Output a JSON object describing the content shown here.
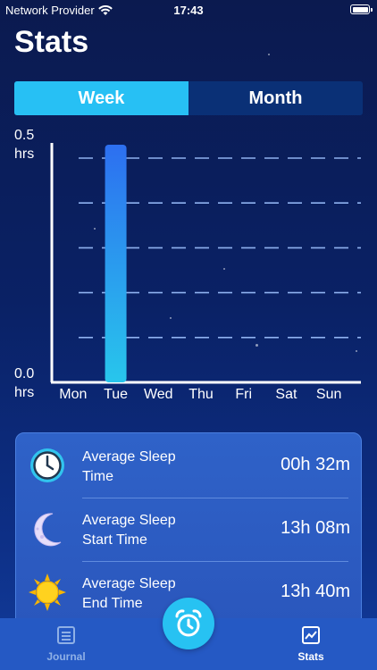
{
  "status_bar": {
    "carrier": "Network Provider",
    "time": "17:43"
  },
  "title": "Stats",
  "segmented": {
    "week": "Week",
    "month": "Month",
    "selected": "Week"
  },
  "chart_data": {
    "type": "bar",
    "categories": [
      "Mon",
      "Tue",
      "Wed",
      "Thu",
      "Fri",
      "Sat",
      "Sun"
    ],
    "values": [
      0,
      0.53,
      0,
      0,
      0,
      0,
      0
    ],
    "ylim": [
      0,
      0.5
    ],
    "y_top_label": {
      "value": "0.5",
      "unit": "hrs"
    },
    "y_bottom_label": {
      "value": "0.0",
      "unit": "hrs"
    },
    "grid": true
  },
  "stats": [
    {
      "label_line1": "Average Sleep",
      "label_line2": "Time",
      "value": "00h 32m",
      "icon": "clock-icon"
    },
    {
      "label_line1": "Average Sleep",
      "label_line2": "Start Time",
      "value": "13h 08m",
      "icon": "moon-icon"
    },
    {
      "label_line1": "Average Sleep",
      "label_line2": "End Time",
      "value": "13h 40m",
      "icon": "sun-icon"
    }
  ],
  "tabbar": {
    "journal": "Journal",
    "stats": "Stats"
  },
  "colors": {
    "accent": "#27c0f4",
    "bar_top": "#2d6ff0",
    "bar_bottom": "#28c6ec",
    "tab_inactive": "#8fb0e6"
  }
}
